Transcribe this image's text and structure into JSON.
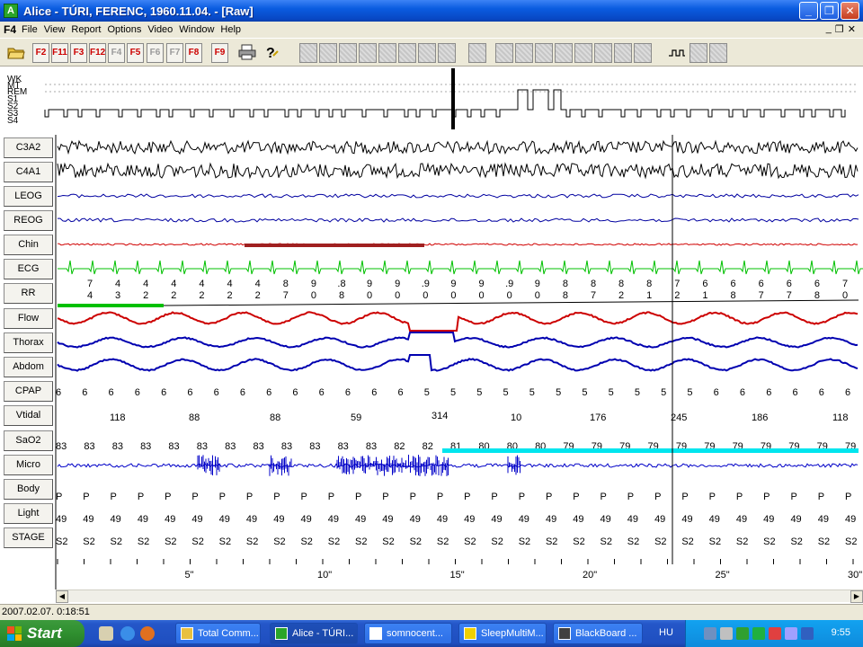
{
  "window": {
    "title": "Alice - TÚRI, FERENC, 1960.11.04.  - [Raw]",
    "app_icon_letter": "A",
    "buttons": [
      "_",
      "❐",
      "✕"
    ]
  },
  "menu": {
    "logo": "F4",
    "items": [
      "File",
      "View",
      "Report",
      "Options",
      "Video",
      "Window",
      "Help"
    ],
    "mdi_buttons": [
      "_",
      "❐",
      "✕"
    ]
  },
  "toolbar": {
    "fkeys": [
      {
        "label": "F2",
        "enabled": true
      },
      {
        "label": "F11",
        "enabled": true
      },
      {
        "label": "F3",
        "enabled": true
      },
      {
        "label": "F12",
        "enabled": true
      },
      {
        "label": "F4",
        "enabled": false
      },
      {
        "label": "F5",
        "enabled": true
      },
      {
        "label": "F6",
        "enabled": false
      },
      {
        "label": "F7",
        "enabled": false
      },
      {
        "label": "F8",
        "enabled": true
      },
      {
        "label": "F9",
        "enabled": true
      }
    ],
    "icons": [
      "open-folder-icon",
      "printer-icon",
      "help-icon",
      "step-signal-icon"
    ]
  },
  "hypnogram": {
    "stage_labels": [
      "WK",
      "MT",
      "REM",
      "S1",
      "S2",
      "S3",
      "S4"
    ]
  },
  "channels": [
    "C3A2",
    "C4A1",
    "LEOG",
    "REOG",
    "Chin",
    "ECG",
    "RR",
    "Flow",
    "Thorax",
    "Abdom",
    "CPAP",
    "Vtidal",
    "SaO2",
    "Micro",
    "Body",
    "Light",
    "STAGE"
  ],
  "colors": {
    "eeg": "#000000",
    "eog": "#0000a0",
    "chin": "#d00000",
    "ecg": "#00c000",
    "flow": "#cc0000",
    "effort": "#0000b0",
    "micro": "#0000c8",
    "sao2_bar": "#00e5ee",
    "rr_bar": "#00c000"
  },
  "rr_labels": [
    {
      "top": "7",
      "bottom": "4"
    },
    {
      "top": "4",
      "bottom": "3"
    },
    {
      "top": "4",
      "bottom": "2"
    },
    {
      "top": "4",
      "bottom": "2"
    },
    {
      "top": "4",
      "bottom": "2"
    },
    {
      "top": "4",
      "bottom": "2"
    },
    {
      "top": "4",
      "bottom": "2"
    },
    {
      "top": "8",
      "bottom": "7"
    },
    {
      "top": "9",
      "bottom": "0"
    },
    {
      "top": ".8",
      "bottom": "8"
    },
    {
      "top": "9",
      "bottom": "0"
    },
    {
      "top": "9",
      "bottom": "0"
    },
    {
      "top": ".9",
      "bottom": "0"
    },
    {
      "top": "9",
      "bottom": "0"
    },
    {
      "top": "9",
      "bottom": "0"
    },
    {
      "top": ".9",
      "bottom": "0"
    },
    {
      "top": "9",
      "bottom": "0"
    },
    {
      "top": "8",
      "bottom": "8"
    },
    {
      "top": "8",
      "bottom": "7"
    },
    {
      "top": "8",
      "bottom": "2"
    },
    {
      "top": "8",
      "bottom": "1"
    },
    {
      "top": "7",
      "bottom": "2"
    },
    {
      "top": "6",
      "bottom": "1"
    },
    {
      "top": "6",
      "bottom": "8"
    },
    {
      "top": "6",
      "bottom": "7"
    },
    {
      "top": "6",
      "bottom": "7"
    },
    {
      "top": "6",
      "bottom": "8"
    },
    {
      "top": "7",
      "bottom": "0"
    }
  ],
  "cpap_values": [
    "6",
    "6",
    "6",
    "6",
    "6",
    "6",
    "6",
    "6",
    "6",
    "6",
    "6",
    "6",
    "6",
    "6",
    "5",
    "5",
    "5",
    "5",
    "5",
    "5",
    "5",
    "5",
    "5",
    "5",
    "5",
    "6",
    "6",
    "6",
    "6",
    "6",
    "6"
  ],
  "vtidal_values": [
    "118",
    "88",
    "88",
    "59",
    "314",
    "10",
    "176",
    "245",
    "186",
    "118"
  ],
  "sao2_values": [
    "83",
    "83",
    "83",
    "83",
    "83",
    "83",
    "83",
    "83",
    "83",
    "83",
    "83",
    "83",
    "82",
    "82",
    "81",
    "80",
    "80",
    "80",
    "79",
    "79",
    "79",
    "79",
    "79",
    "79",
    "79",
    "79",
    "79",
    "79",
    "79"
  ],
  "body_values": [
    "P",
    "P",
    "P",
    "P",
    "P",
    "P",
    "P",
    "P",
    "P",
    "P",
    "P",
    "P",
    "P",
    "P",
    "P",
    "P",
    "P",
    "P",
    "P",
    "P",
    "P",
    "P",
    "P",
    "P",
    "P",
    "P",
    "P",
    "P",
    "P",
    "P"
  ],
  "light_values": [
    "49",
    "49",
    "49",
    "49",
    "49",
    "49",
    "49",
    "49",
    "49",
    "49",
    "49",
    "49",
    "49",
    "49",
    "49",
    "49",
    "49",
    "49",
    "49",
    "49",
    "49",
    "49",
    "49",
    "49",
    "49",
    "49",
    "49",
    "49",
    "49",
    "49"
  ],
  "stage_values": [
    "S2",
    "S2",
    "S2",
    "S2",
    "S2",
    "S2",
    "S2",
    "S2",
    "S2",
    "S2",
    "S2",
    "S2",
    "S2",
    "S2",
    "S2",
    "S2",
    "S2",
    "S2",
    "S2",
    "S2",
    "S2",
    "S2",
    "S2",
    "S2",
    "S2",
    "S2",
    "S2",
    "S2",
    "S2",
    "S2"
  ],
  "time_axis": {
    "labels": [
      "5\"",
      "10\"",
      "15\"",
      "20\"",
      "25\"",
      "30\""
    ]
  },
  "statusbar": {
    "text": "2007.02.07. 0:18:51"
  },
  "taskbar": {
    "start_label": "Start",
    "tasks": [
      {
        "label": "Total Comm...",
        "active": false,
        "icon_color": "#e8c040"
      },
      {
        "label": "Alice - TÚRI...",
        "active": true,
        "icon_color": "#2aa52a"
      },
      {
        "label": "somnocent...",
        "active": false,
        "icon_color": "#ffffff"
      },
      {
        "label": "SleepMultiM...",
        "active": false,
        "icon_color": "#f0d000"
      },
      {
        "label": "BlackBoard ...",
        "active": false,
        "icon_color": "#404040"
      }
    ],
    "language": "HU",
    "clock": "9:55"
  }
}
